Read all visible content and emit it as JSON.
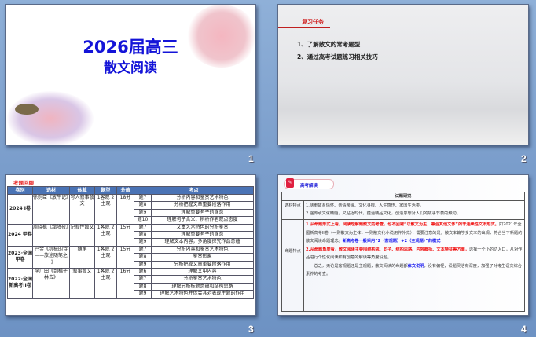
{
  "slides": [
    {
      "number": "1",
      "title_line1": "2026届高三",
      "title_line2": "散文阅读"
    },
    {
      "number": "2",
      "heading": "复习任务",
      "items": [
        "1、了解散文的常考题型",
        "2、通过高考试题练习相关技巧"
      ]
    },
    {
      "number": "3",
      "heading": "考题回顾",
      "headers": [
        "卷别",
        "选材",
        "体裁",
        "题型",
        "分值",
        "考点"
      ],
      "groups": [
        {
          "paper": "2024 I卷",
          "source": "徐则臣《放牛记》",
          "genre": "写人叙事散文",
          "type": "1客观 2主观",
          "score": "18分",
          "items": [
            [
              "题7",
              "分析内容和鉴赏艺术特色"
            ],
            [
              "题8",
              "分析把握文章重要段落作用"
            ],
            [
              "题9",
              "理解重要句子的含意"
            ],
            [
              "题10",
              "理解句子含义、辨析作者观点态度"
            ]
          ]
        },
        {
          "paper": "2024 甲卷",
          "source": "周晓枫《霜降夜》",
          "genre": "记叙性散文",
          "type": "1客观 2主观",
          "score": "15分",
          "items": [
            [
              "题7",
              "文本艺术特色的分析鉴赏"
            ],
            [
              "题8",
              "理解重要句子的含意"
            ],
            [
              "题9",
              "理解文本内容，多角度探究作品意蕴"
            ]
          ]
        },
        {
          "paper": "2023·全国甲卷",
          "source": "巴金《机械的诗——旅途随笔之一》",
          "genre": "随笔",
          "type": "1客观 2主观",
          "score": "15分",
          "items": [
            [
              "题7",
              "分析内容和鉴赏艺术特色"
            ],
            [
              "题8",
              "鉴赏形象"
            ],
            [
              "题9",
              "分析把握文章重要段落作用"
            ]
          ]
        },
        {
          "paper": "2022·全国新高考II卷",
          "source": "李广田《到橘子林去》",
          "genre": "叙事散文",
          "type": "1客观 2主观",
          "score": "16分",
          "items": [
            [
              "题6",
              "理解文中内容"
            ],
            [
              "题7",
              "分析鉴赏艺术特色"
            ],
            [
              "题8",
              "理解分析标题意蕴和结构思路"
            ],
            [
              "题9",
              "理解艺术特色并体会其对表现主题的作用"
            ]
          ]
        }
      ]
    },
    {
      "number": "4",
      "badge": "高考解读",
      "table_title": "试题研究",
      "row1_label": "选材特点",
      "row1_lines": [
        "1.侧重故乡情怀、亲情亲缘、文化寻根、人生感悟、家国生活类。",
        "2.强传承文化精髓，又贴近时代，蕴涵精品文化，创造思想对人们的故事节奏的触动。"
      ],
      "row2_label": "命题特点",
      "p1_red": "1.从命题形式上看，阅读理解题散文的考查，也不回避“以散文为主，兼合其他文体”的非连续性文本形式。",
      "p1_text": "如2021年全国新高考II卷（一则散文为主体，一则散文化小说用作补充），需要注意的是，散文本篇学多文本的出现，符合当下新题的散文阅读命题理念。",
      "p1_blue": "新高考卷一般采用“2（客观题）+2（主观题）”的模式",
      "p2_red": "2.从命题角度看，散文阅读主要围绕构思、句子、结构思路、内容概括、文本特征等方面，",
      "p2_text": "选择一个小的切入口，从对作品进行个性化阅读和有创意的解读等角度设题。",
      "p3_text1": "总之，无论是客观题还是主观题，散文阅读的命题都",
      "p3_blue": "体文说明",
      "p3_text2": "，没有偏怪，设题灵活有深度，加强了对考生语文综合素养的考查。"
    }
  ]
}
